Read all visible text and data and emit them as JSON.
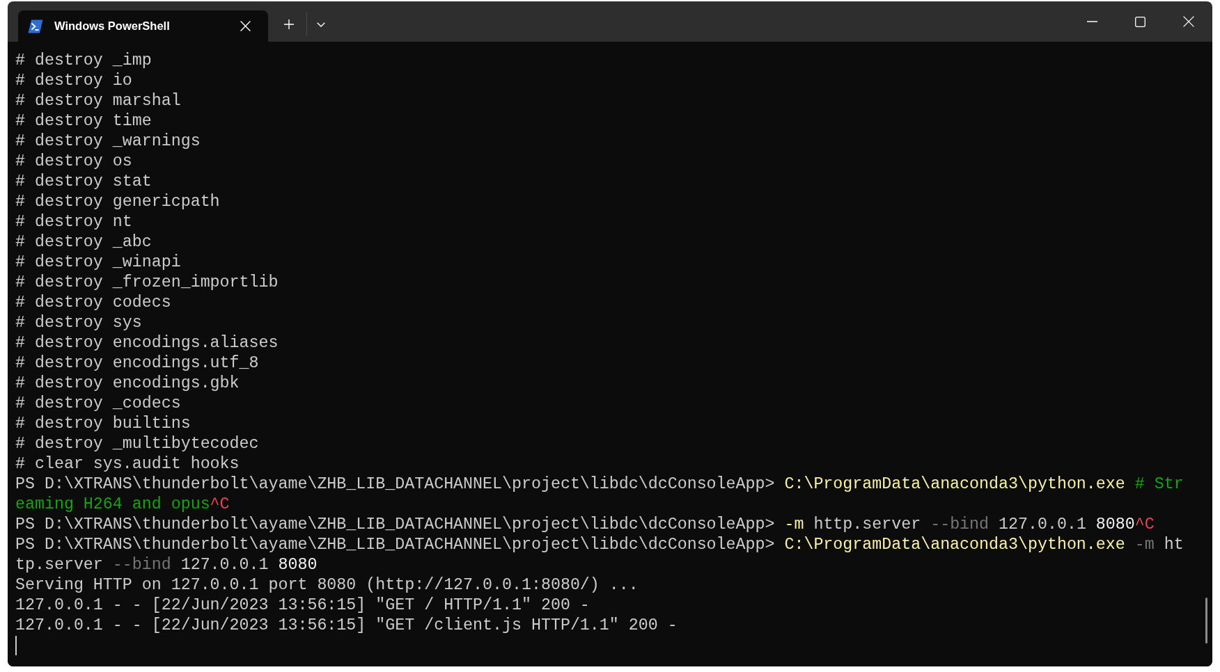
{
  "window": {
    "tabs": [
      {
        "label": "Windows PowerShell",
        "selected": true
      }
    ]
  },
  "terminal": {
    "lines": [
      {
        "segments": [
          {
            "text": "# destroy _imp",
            "kind": "plain"
          }
        ]
      },
      {
        "segments": [
          {
            "text": "# destroy io",
            "kind": "plain"
          }
        ]
      },
      {
        "segments": [
          {
            "text": "# destroy marshal",
            "kind": "plain"
          }
        ]
      },
      {
        "segments": [
          {
            "text": "# destroy time",
            "kind": "plain"
          }
        ]
      },
      {
        "segments": [
          {
            "text": "# destroy _warnings",
            "kind": "plain"
          }
        ]
      },
      {
        "segments": [
          {
            "text": "# destroy os",
            "kind": "plain"
          }
        ]
      },
      {
        "segments": [
          {
            "text": "# destroy stat",
            "kind": "plain"
          }
        ]
      },
      {
        "segments": [
          {
            "text": "# destroy genericpath",
            "kind": "plain"
          }
        ]
      },
      {
        "segments": [
          {
            "text": "# destroy nt",
            "kind": "plain"
          }
        ]
      },
      {
        "segments": [
          {
            "text": "# destroy _abc",
            "kind": "plain"
          }
        ]
      },
      {
        "segments": [
          {
            "text": "# destroy _winapi",
            "kind": "plain"
          }
        ]
      },
      {
        "segments": [
          {
            "text": "# destroy _frozen_importlib",
            "kind": "plain"
          }
        ]
      },
      {
        "segments": [
          {
            "text": "# destroy codecs",
            "kind": "plain"
          }
        ]
      },
      {
        "segments": [
          {
            "text": "# destroy sys",
            "kind": "plain"
          }
        ]
      },
      {
        "segments": [
          {
            "text": "# destroy encodings.aliases",
            "kind": "plain"
          }
        ]
      },
      {
        "segments": [
          {
            "text": "# destroy encodings.utf_8",
            "kind": "plain"
          }
        ]
      },
      {
        "segments": [
          {
            "text": "# destroy encodings.gbk",
            "kind": "plain"
          }
        ]
      },
      {
        "segments": [
          {
            "text": "# destroy _codecs",
            "kind": "plain"
          }
        ]
      },
      {
        "segments": [
          {
            "text": "# destroy builtins",
            "kind": "plain"
          }
        ]
      },
      {
        "segments": [
          {
            "text": "# destroy _multibytecodec",
            "kind": "plain"
          }
        ]
      },
      {
        "segments": [
          {
            "text": "# clear sys.audit hooks",
            "kind": "plain"
          }
        ]
      },
      {
        "segments": [
          {
            "text": "PS D:\\XTRANS\\thunderbolt\\ayame\\ZHB_LIB_DATACHANNEL\\project\\libdc\\dcConsoleApp> ",
            "kind": "plain"
          },
          {
            "text": "C:\\ProgramData\\anaconda3\\python.exe",
            "kind": "command"
          },
          {
            "text": " # Str",
            "kind": "comment"
          }
        ]
      },
      {
        "segments": [
          {
            "text": "eaming H264 and opus",
            "kind": "comment"
          },
          {
            "text": "^C",
            "kind": "interrupt"
          }
        ]
      },
      {
        "segments": [
          {
            "text": "PS D:\\XTRANS\\thunderbolt\\ayame\\ZHB_LIB_DATACHANNEL\\project\\libdc\\dcConsoleApp> ",
            "kind": "plain"
          },
          {
            "text": "-m",
            "kind": "command"
          },
          {
            "text": " http.server ",
            "kind": "plain"
          },
          {
            "text": "--bind",
            "kind": "dim"
          },
          {
            "text": " 127.0.0.1 ",
            "kind": "plain"
          },
          {
            "text": "8080",
            "kind": "bright"
          },
          {
            "text": "^C",
            "kind": "interrupt"
          }
        ]
      },
      {
        "segments": [
          {
            "text": "PS D:\\XTRANS\\thunderbolt\\ayame\\ZHB_LIB_DATACHANNEL\\project\\libdc\\dcConsoleApp> ",
            "kind": "plain"
          },
          {
            "text": "C:\\ProgramData\\anaconda3\\python.exe",
            "kind": "command"
          },
          {
            "text": " -m",
            "kind": "dim"
          },
          {
            "text": " ht",
            "kind": "plain"
          }
        ]
      },
      {
        "segments": [
          {
            "text": "tp.server ",
            "kind": "plain"
          },
          {
            "text": "--bind",
            "kind": "dim"
          },
          {
            "text": " 127.0.0.1 ",
            "kind": "plain"
          },
          {
            "text": "8080",
            "kind": "bright"
          }
        ]
      },
      {
        "segments": [
          {
            "text": "Serving HTTP on 127.0.0.1 port 8080 (http://127.0.0.1:8080/) ...",
            "kind": "plain"
          }
        ]
      },
      {
        "segments": [
          {
            "text": "127.0.0.1 - - [22/Jun/2023 13:56:15] \"GET / HTTP/1.1\" 200 -",
            "kind": "plain"
          }
        ]
      },
      {
        "segments": [
          {
            "text": "127.0.0.1 - - [22/Jun/2023 13:56:15] \"GET /client.js HTTP/1.1\" 200 -",
            "kind": "plain"
          }
        ]
      }
    ]
  }
}
